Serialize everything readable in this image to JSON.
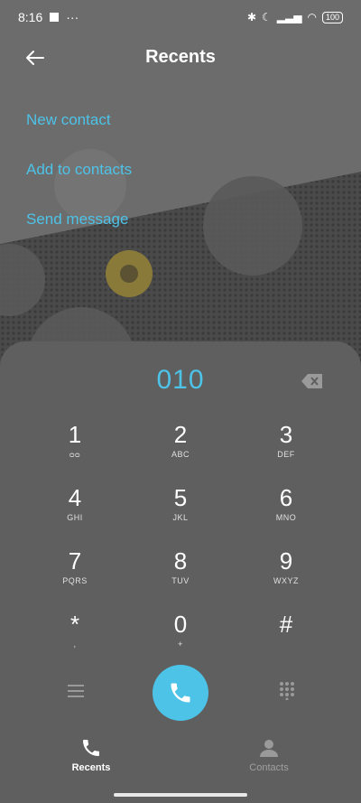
{
  "status_bar": {
    "time": "8:16",
    "dots": "···",
    "battery": "100"
  },
  "header": {
    "title": "Recents"
  },
  "actions": [
    "New contact",
    "Add to contacts",
    "Send message"
  ],
  "dialer": {
    "number": "010",
    "keys": [
      {
        "digit": "1",
        "sub": "ᴑᴑ"
      },
      {
        "digit": "2",
        "sub": "ABC"
      },
      {
        "digit": "3",
        "sub": "DEF"
      },
      {
        "digit": "4",
        "sub": "GHI"
      },
      {
        "digit": "5",
        "sub": "JKL"
      },
      {
        "digit": "6",
        "sub": "MNO"
      },
      {
        "digit": "7",
        "sub": "PQRS"
      },
      {
        "digit": "8",
        "sub": "TUV"
      },
      {
        "digit": "9",
        "sub": "WXYZ"
      },
      {
        "digit": "*",
        "sub": ","
      },
      {
        "digit": "0",
        "sub": "+"
      },
      {
        "digit": "#",
        "sub": ""
      }
    ]
  },
  "tabs": {
    "recents": "Recents",
    "contacts": "Contacts"
  },
  "colors": {
    "accent": "#4dc3e8",
    "panel": "#5f5f5f"
  }
}
